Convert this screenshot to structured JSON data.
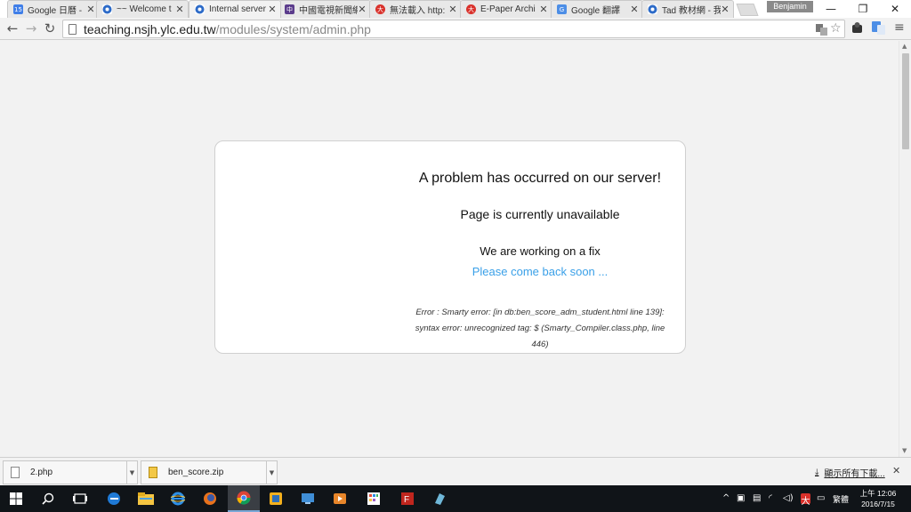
{
  "browser": {
    "tabs": [
      {
        "label": "Google 日曆 -",
        "icon": "calendar-icon",
        "color": "#3f7ee8",
        "badge": "15"
      },
      {
        "label": "~~ Welcome t",
        "icon": "chrome-page-icon",
        "color": "#2d6bc8",
        "badge": ""
      },
      {
        "label": "Internal server",
        "icon": "chrome-page-icon",
        "color": "#2d6bc8",
        "badge": ""
      },
      {
        "label": "中國電視新聞網",
        "icon": "cctv-icon",
        "color": "#5b3c8c",
        "badge": ""
      },
      {
        "label": "無法載入 http:",
        "icon": "error-icon",
        "color": "#d9312b",
        "badge": ""
      },
      {
        "label": "E-Paper Archi",
        "icon": "error-icon",
        "color": "#d9312b",
        "badge": ""
      },
      {
        "label": "Google 翻譯",
        "icon": "translate-icon",
        "color": "#4d8ee6",
        "badge": ""
      },
      {
        "label": "Tad 教材網 - 我",
        "icon": "chrome-page-icon",
        "color": "#2d6bc8",
        "badge": ""
      }
    ],
    "active_tab": 2,
    "user": "Benjamin",
    "address": {
      "host": "teaching.nsjh.ylc.edu.tw",
      "path": "/modules/system/admin.php"
    }
  },
  "page": {
    "title": "A problem has occurred on our server!",
    "subtitle": "Page is currently unavailable",
    "fix": "We are working on a fix",
    "come_back": "Please come back soon ...",
    "detail_1": "Error : Smarty error: [in db:ben_score_adm_student.html line 139]:",
    "detail_2": "syntax error: unrecognized tag: $ (Smarty_Compiler.class.php, line",
    "detail_3": "446)",
    "accent_color": "#3aa0e8"
  },
  "downloads": {
    "items": [
      {
        "name": "2.php",
        "icon": "php-file-icon"
      },
      {
        "name": "ben_score.zip",
        "icon": "zip-file-icon"
      }
    ],
    "show_all": "顯示所有下載..."
  },
  "taskbar": {
    "ime": "繁體",
    "time": "上午 12:06",
    "date": "2016/7/15"
  }
}
